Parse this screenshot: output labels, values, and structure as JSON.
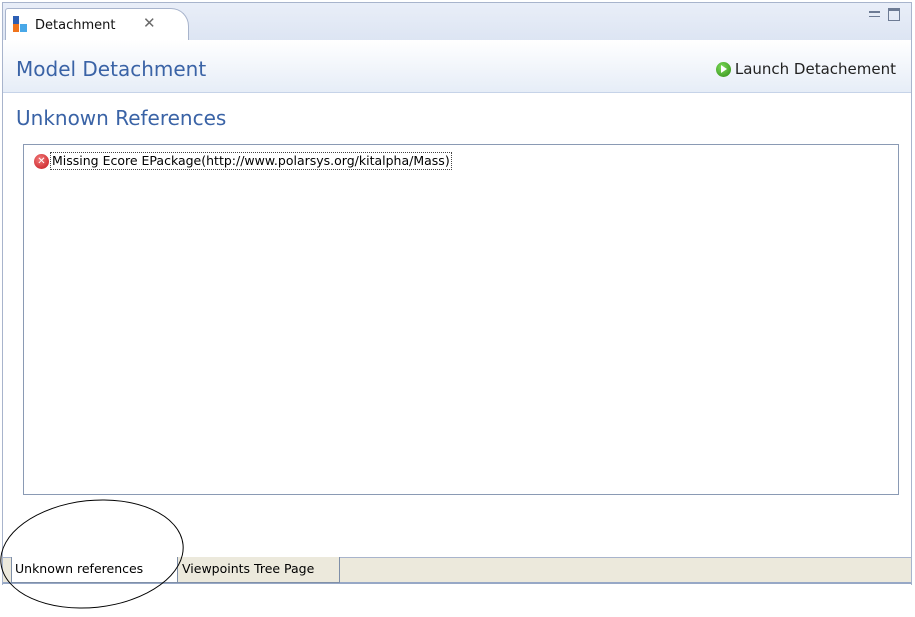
{
  "view_tab": {
    "title": "Detachment",
    "close_glyph": "✕",
    "icon": "detachment-view-icon"
  },
  "window_controls": {
    "minimize_icon": "minimize-icon",
    "maximize_icon": "maximize-icon"
  },
  "form": {
    "title": "Model Detachment",
    "launch_label": "Launch Detachement",
    "launch_icon": "run-icon"
  },
  "section": {
    "title": "Unknown References"
  },
  "list": {
    "items": [
      {
        "icon": "error-icon",
        "label": "Missing Ecore EPackage(http://www.polarsys.org/kitalpha/Mass)"
      }
    ]
  },
  "page_tabs": [
    {
      "label": "Unknown references",
      "active": true
    },
    {
      "label": "Viewpoints Tree Page",
      "active": false
    }
  ],
  "colors": {
    "header_text": "#3a63a6",
    "error": "#c4151b",
    "run": "#2e8a14"
  }
}
